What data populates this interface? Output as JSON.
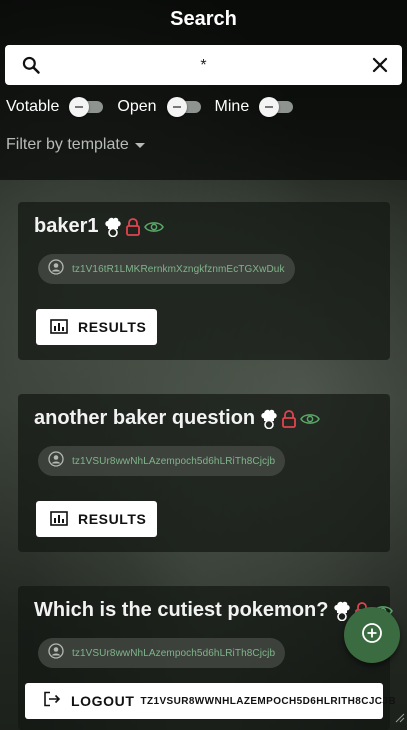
{
  "header": {
    "title": "Search",
    "search": {
      "value": "*",
      "search_icon": "search-icon",
      "clear_icon": "close-icon"
    },
    "filters": [
      {
        "label": "Votable",
        "on": false
      },
      {
        "label": "Open",
        "on": false
      },
      {
        "label": "Mine",
        "on": false
      }
    ],
    "template_filter": {
      "label": "Filter by template",
      "icon": "caret-down-icon"
    }
  },
  "cards": [
    {
      "title": "baker1",
      "badges": [
        "baker-icon",
        "lock-icon",
        "eye-icon"
      ],
      "address": "tz1V16tR1LMKRernkmXzngkfznmEcTGXwDuk",
      "results_label": "RESULTS"
    },
    {
      "title": "another baker question",
      "badges": [
        "baker-icon",
        "lock-icon",
        "eye-icon"
      ],
      "address": "tz1VSUr8wwNhLAzempoch5d6hLRiTh8Cjcjb",
      "results_label": "RESULTS"
    },
    {
      "title": "Which is the cutiest pokemon?",
      "badges": [
        "baker-icon",
        "lock-icon",
        "eye-icon"
      ],
      "address": "tz1VSUr8wwNhLAzempoch5d6hLRiTh8Cjcjb"
    }
  ],
  "fab": {
    "icon": "add-circle-icon"
  },
  "logout": {
    "label": "LOGOUT",
    "address": "TZ1VSUR8WWNHLAZEMPOCH5D6HLRITH8CJCJB",
    "icon": "logout-icon"
  },
  "colors": {
    "accent_green": "#3b6b40",
    "lock_red": "#e0444f",
    "eye_green": "#5aa868",
    "address_green": "#7fb58a"
  }
}
